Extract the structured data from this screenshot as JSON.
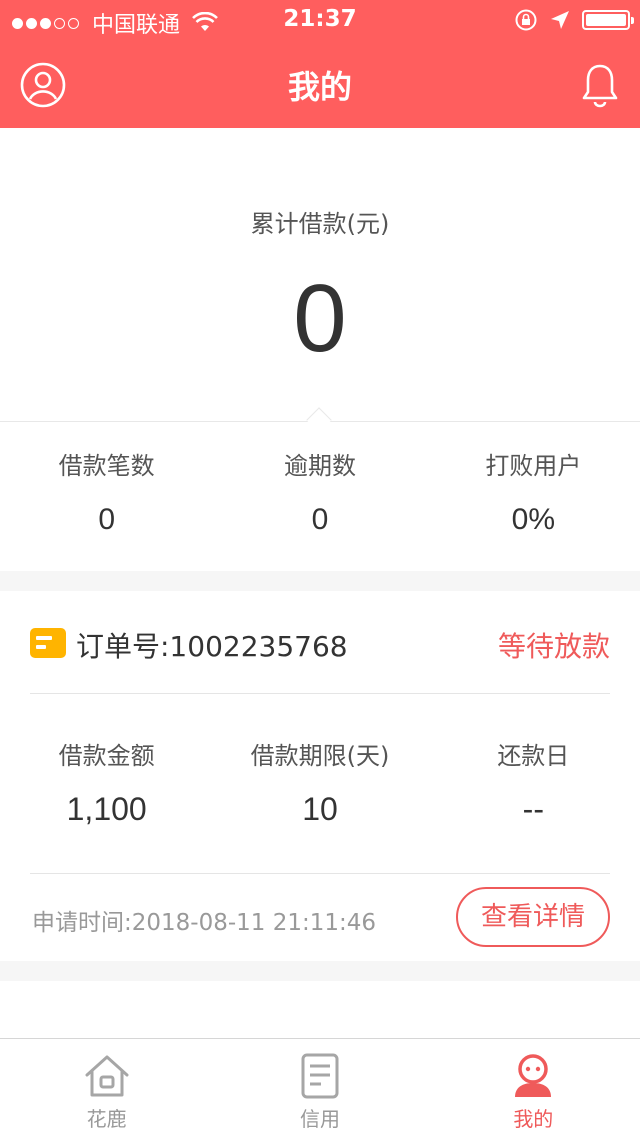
{
  "status_bar": {
    "carrier": "中国联通",
    "time": "21:37"
  },
  "nav": {
    "title": "我的",
    "left_icon": "profile-icon",
    "right_icon": "bell-icon"
  },
  "summary": {
    "label": "累计借款(元)",
    "value": "0",
    "stats": [
      {
        "label": "借款笔数",
        "value": "0"
      },
      {
        "label": "逾期数",
        "value": "0"
      },
      {
        "label": "打败用户",
        "value": "0%"
      }
    ]
  },
  "order": {
    "number": "订单号:1002235768",
    "status": "等待放款",
    "stats": [
      {
        "label": "借款金额",
        "value": "1,100"
      },
      {
        "label": "借款期限(天)",
        "value": "10"
      },
      {
        "label": "还款日",
        "value": "--"
      }
    ],
    "apply_time": "申请时间:2018-08-11 21:11:46",
    "detail_button": "查看详情"
  },
  "tabbar": {
    "items": [
      {
        "label": "花鹿",
        "icon": "home-icon",
        "active": false
      },
      {
        "label": "信用",
        "icon": "document-icon",
        "active": false
      },
      {
        "label": "我的",
        "icon": "user-icon",
        "active": true
      }
    ]
  },
  "colors": {
    "header": "#ff5e5e",
    "accent": "#ef5a5a",
    "order_icon": "#ffb400"
  }
}
